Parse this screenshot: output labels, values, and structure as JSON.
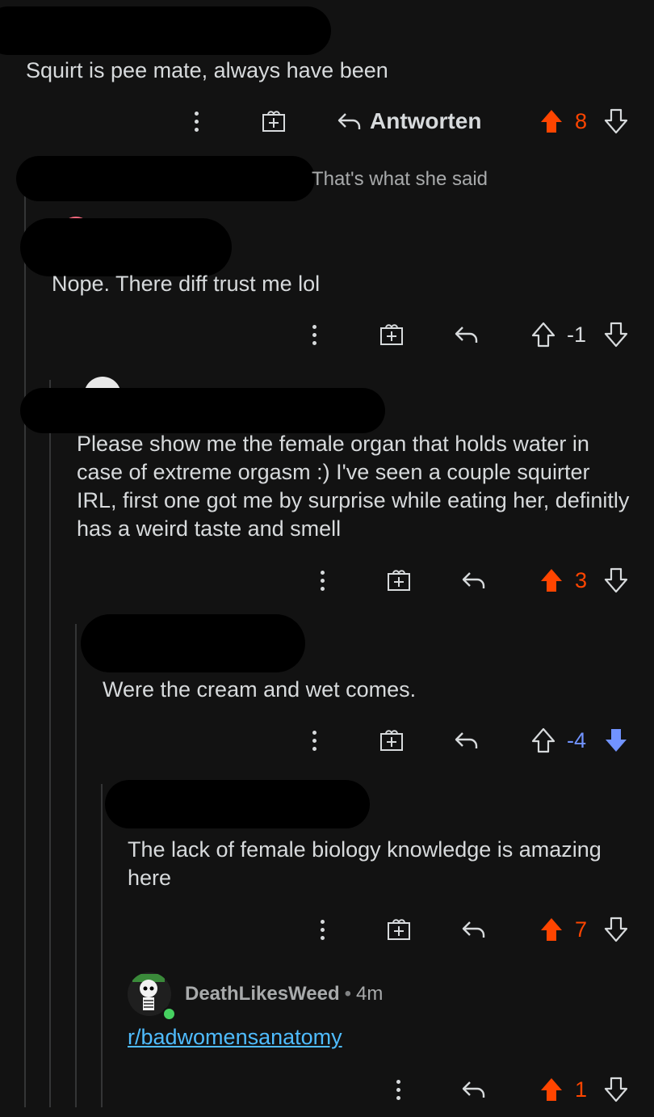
{
  "comments": [
    {
      "body": "Squirt is pee mate, always have been",
      "score": "8",
      "reply_label": "Antworten"
    },
    {
      "quote": "That's what she said"
    },
    {
      "body": "Nope. There diff trust me lol",
      "score": "-1"
    },
    {
      "body": "Please show me the female organ that holds water in case of extreme orgasm :) I've seen a couple squirter IRL, first one got me by surprise while eating her, definitly has a weird taste and smell",
      "score": "3"
    },
    {
      "body": "Were the cream and wet comes.",
      "score": "-4"
    },
    {
      "body": "The lack of female biology knowledge is amazing here",
      "score": "7"
    },
    {
      "username": "DeathLikesWeed",
      "time": "4m",
      "link": "r/badwomensanatomy",
      "score": "1"
    }
  ],
  "colors": {
    "background": "#121212",
    "upvote": "#ff4500",
    "downvote": "#7193ff",
    "link": "#4fbcff",
    "thread_line": "#343536"
  },
  "icons": [
    "more-vertical-icon",
    "award-gift-icon",
    "reply-arrow-icon",
    "upvote-arrow-icon",
    "downvote-arrow-icon"
  ]
}
